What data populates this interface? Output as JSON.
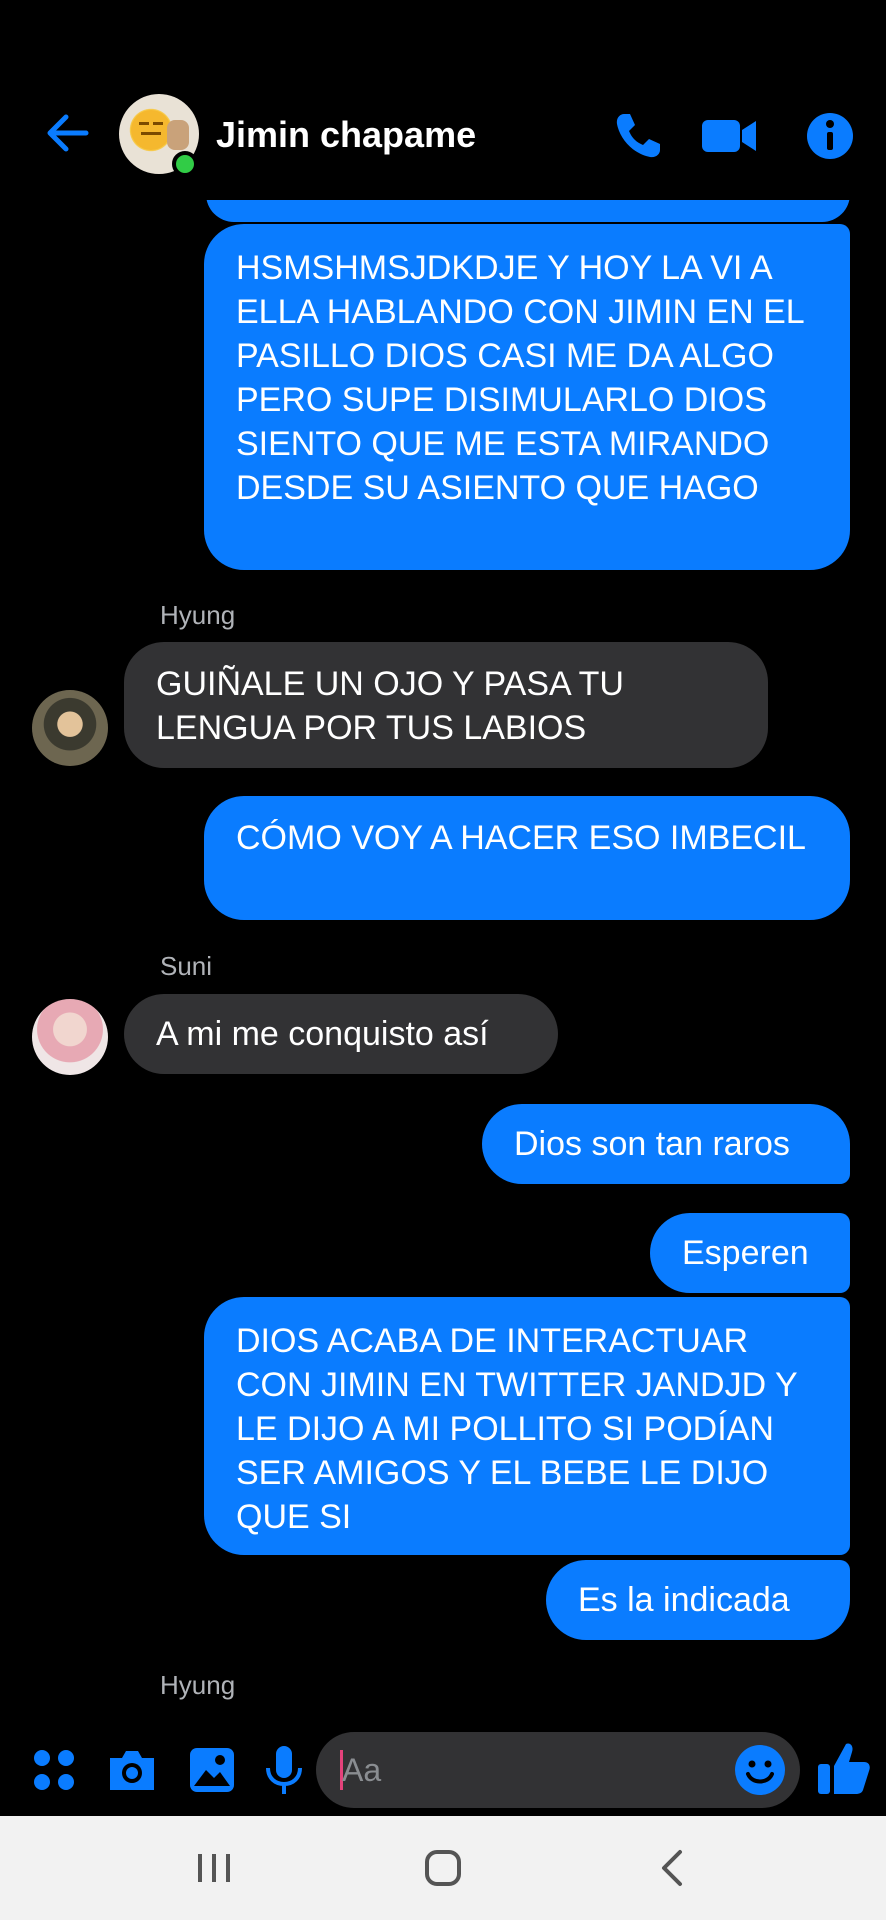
{
  "header": {
    "title": "Jimin chapame",
    "accent": "#0a7cff",
    "online_color": "#31cc46",
    "icons": [
      "arrow-left-icon",
      "phone-icon",
      "video-camera-icon",
      "info-icon"
    ]
  },
  "messages": [
    {
      "direction": "outgoing",
      "text": "HSMSHMSJDKDJE Y HOY LA VI A ELLA HABLANDO CON JIMIN EN EL PASILLO DIOS CASI ME DA ALGO PERO SUPE DISIMULARLO DIOS SIENTO QUE ME ESTA MIRANDO DESDE SU ASIENTO QUE HAGO"
    },
    {
      "direction": "incoming",
      "sender": "Hyung",
      "text": "GUIÑALE UN OJO Y PASA TU LENGUA POR TUS LABIOS"
    },
    {
      "direction": "outgoing",
      "text": "CÓMO VOY A HACER ESO IMBECIL"
    },
    {
      "direction": "incoming",
      "sender": "Suni",
      "text": "A mi me conquisto así"
    },
    {
      "direction": "outgoing",
      "text": "Dios son tan raros"
    },
    {
      "direction": "outgoing",
      "text": "Esperen"
    },
    {
      "direction": "outgoing",
      "text": "DIOS ACABA DE INTERACTUAR CON JIMIN EN TWITTER JANDJD Y LE DIJO A MI POLLITO SI PODÍAN SER AMIGOS Y EL BEBE LE DIJO QUE SI"
    },
    {
      "direction": "outgoing",
      "text": "Es la indicada"
    },
    {
      "direction": "incoming",
      "sender": "Hyung",
      "text": ""
    }
  ],
  "composer": {
    "placeholder": "Aa",
    "icons": [
      "apps-grid-icon",
      "camera-icon",
      "image-icon",
      "microphone-icon",
      "emoji-icon",
      "thumbs-up-icon"
    ]
  },
  "navbar": {
    "icons": [
      "recent-apps-icon",
      "home-icon",
      "back-icon"
    ]
  }
}
